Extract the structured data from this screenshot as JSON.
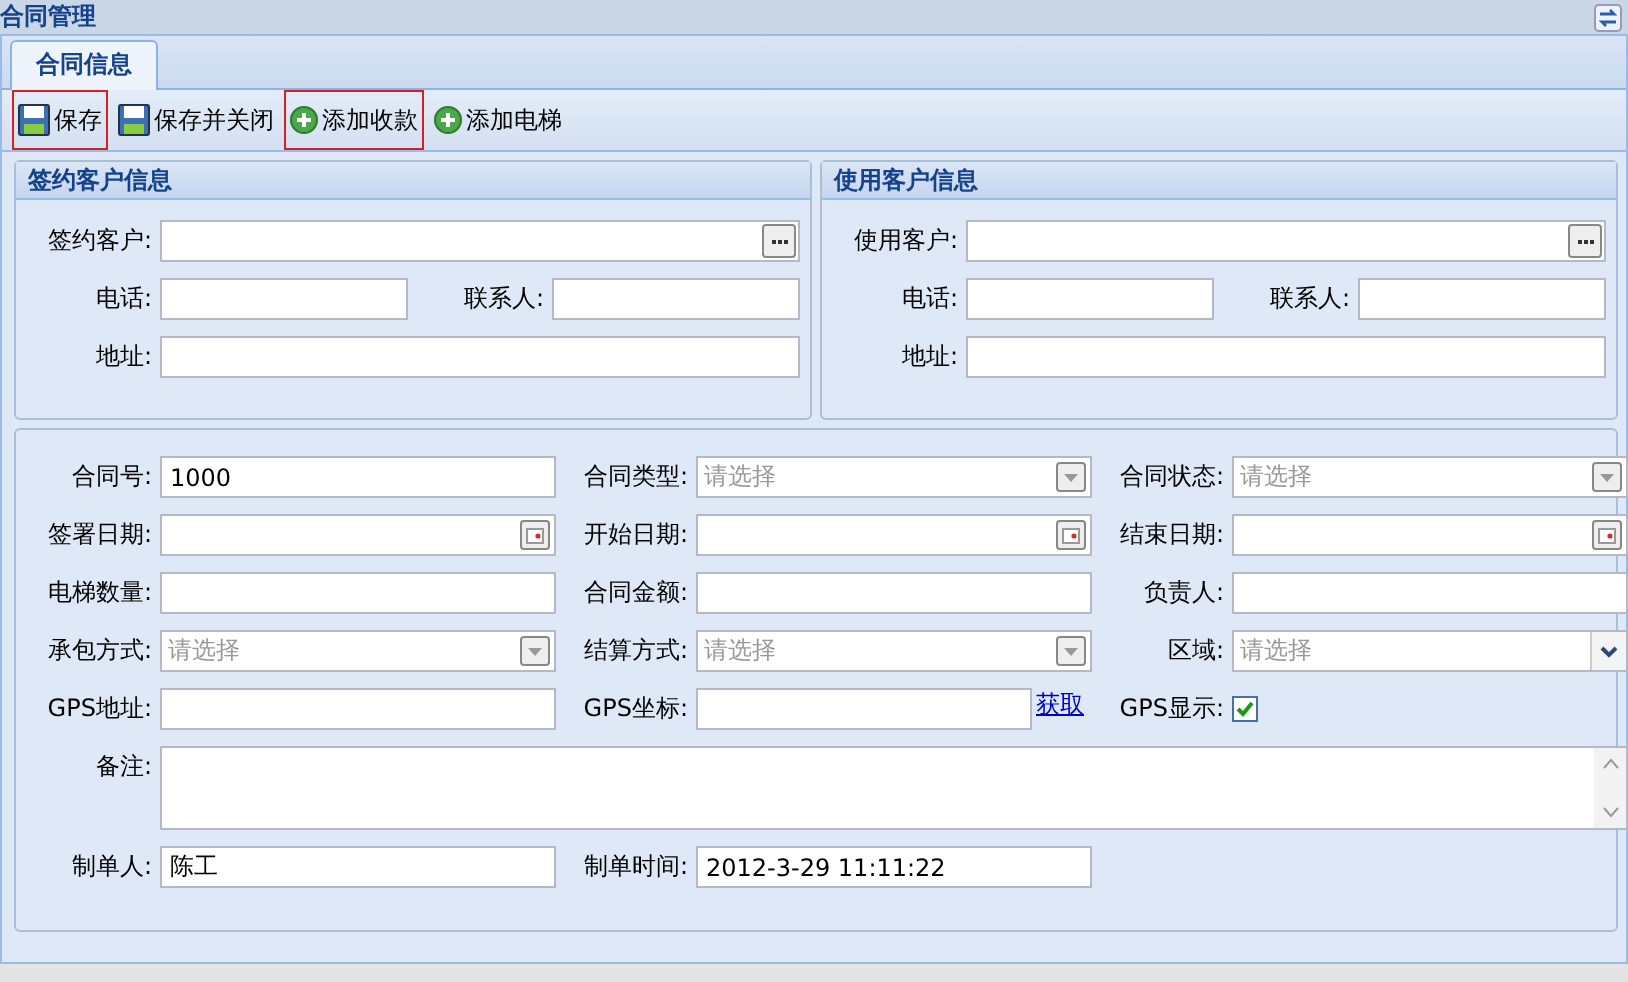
{
  "window": {
    "title": "合同管理"
  },
  "tabs": [
    {
      "label": "合同信息",
      "selected": true
    }
  ],
  "toolbar": [
    {
      "label": "保存",
      "kind": "save",
      "highlighted": true
    },
    {
      "label": "保存并关闭",
      "kind": "save",
      "highlighted": false
    },
    {
      "label": "添加收款",
      "kind": "add",
      "highlighted": true
    },
    {
      "label": "添加电梯",
      "kind": "add",
      "highlighted": false
    }
  ],
  "customer_panels": [
    {
      "title": "签约客户信息",
      "rows": [
        [
          {
            "label": "签约客户:",
            "kind": "lookup"
          }
        ],
        [
          {
            "label": "电话:",
            "kind": "text"
          },
          {
            "label": "联系人:",
            "kind": "text"
          }
        ],
        [
          {
            "label": "地址:",
            "kind": "text"
          }
        ]
      ]
    },
    {
      "title": "使用客户信息",
      "rows": [
        [
          {
            "label": "使用客户:",
            "kind": "lookup"
          }
        ],
        [
          {
            "label": "电话:",
            "kind": "text"
          },
          {
            "label": "联系人:",
            "kind": "text"
          }
        ],
        [
          {
            "label": "地址:",
            "kind": "text"
          }
        ]
      ]
    }
  ],
  "contract": {
    "rows": [
      [
        {
          "label": "合同号:",
          "kind": "text",
          "value": "1000"
        },
        {
          "label": "合同类型:",
          "kind": "combo",
          "placeholder": "请选择"
        },
        {
          "label": "合同状态:",
          "kind": "combo",
          "placeholder": "请选择"
        }
      ],
      [
        {
          "label": "签署日期:",
          "kind": "date"
        },
        {
          "label": "开始日期:",
          "kind": "date"
        },
        {
          "label": "结束日期:",
          "kind": "date"
        }
      ],
      [
        {
          "label": "电梯数量:",
          "kind": "text"
        },
        {
          "label": "合同金额:",
          "kind": "text"
        },
        {
          "label": "负责人:",
          "kind": "text"
        }
      ],
      [
        {
          "label": "承包方式:",
          "kind": "combo",
          "placeholder": "请选择"
        },
        {
          "label": "结算方式:",
          "kind": "combo",
          "placeholder": "请选择"
        },
        {
          "label": "区域:",
          "kind": "select",
          "placeholder": "请选择"
        }
      ],
      [
        {
          "label": "GPS地址:",
          "kind": "text"
        },
        {
          "label": "GPS坐标:",
          "kind": "text",
          "link": "获取"
        },
        {
          "label": "GPS显示:",
          "kind": "checkbox",
          "checked": true
        }
      ],
      [
        {
          "label": "备注:",
          "kind": "textarea"
        }
      ],
      [
        {
          "label": "制单人:",
          "kind": "text",
          "value": "陈工"
        },
        {
          "label": "制单时间:",
          "kind": "text",
          "value": "2012-3-29 11:11:22"
        }
      ]
    ]
  }
}
